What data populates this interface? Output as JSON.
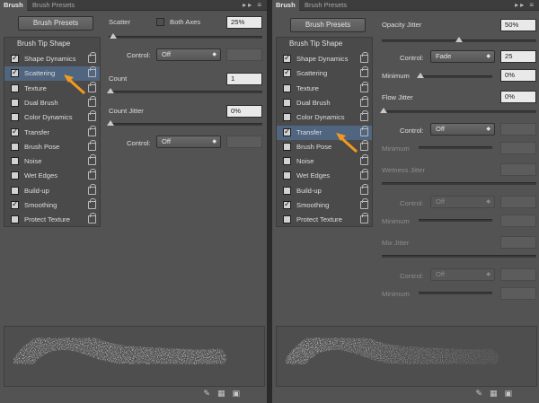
{
  "left": {
    "tabs": [
      "Brush",
      "Brush Presets"
    ],
    "presets_button": "Brush Presets",
    "tip_shape": "Brush Tip Shape",
    "items": [
      {
        "label": "Shape Dynamics",
        "checked": true,
        "selected": false
      },
      {
        "label": "Scattering",
        "checked": true,
        "selected": true
      },
      {
        "label": "Texture",
        "checked": false,
        "selected": false
      },
      {
        "label": "Dual Brush",
        "checked": false,
        "selected": false
      },
      {
        "label": "Color Dynamics",
        "checked": false,
        "selected": false
      },
      {
        "label": "Transfer",
        "checked": true,
        "selected": false
      },
      {
        "label": "Brush Pose",
        "checked": false,
        "selected": false
      },
      {
        "label": "Noise",
        "checked": false,
        "selected": false
      },
      {
        "label": "Wet Edges",
        "checked": false,
        "selected": false
      },
      {
        "label": "Build-up",
        "checked": false,
        "selected": false
      },
      {
        "label": "Smoothing",
        "checked": true,
        "selected": false
      },
      {
        "label": "Protect Texture",
        "checked": false,
        "selected": false
      }
    ],
    "scatter_label": "Scatter",
    "both_axes_label": "Both Axes",
    "scatter_value": "25%",
    "scatter_pct": 0.03,
    "control_label": "Control:",
    "control_value": "Off",
    "count_label": "Count",
    "count_value": "1",
    "count_jitter_label": "Count Jitter",
    "count_jitter_value": "0%",
    "control2_label": "Control:",
    "control2_value": "Off"
  },
  "right": {
    "tabs": [
      "Brush",
      "Brush Presets"
    ],
    "presets_button": "Brush Presets",
    "tip_shape": "Brush Tip Shape",
    "items": [
      {
        "label": "Shape Dynamics",
        "checked": true,
        "selected": false
      },
      {
        "label": "Scattering",
        "checked": true,
        "selected": false
      },
      {
        "label": "Texture",
        "checked": false,
        "selected": false
      },
      {
        "label": "Dual Brush",
        "checked": false,
        "selected": false
      },
      {
        "label": "Color Dynamics",
        "checked": false,
        "selected": false
      },
      {
        "label": "Transfer",
        "checked": true,
        "selected": true
      },
      {
        "label": "Brush Pose",
        "checked": false,
        "selected": false
      },
      {
        "label": "Noise",
        "checked": false,
        "selected": false
      },
      {
        "label": "Wet Edges",
        "checked": false,
        "selected": false
      },
      {
        "label": "Build-up",
        "checked": false,
        "selected": false
      },
      {
        "label": "Smoothing",
        "checked": true,
        "selected": false
      },
      {
        "label": "Protect Texture",
        "checked": false,
        "selected": false
      }
    ],
    "opacity_jitter_label": "Opacity Jitter",
    "opacity_jitter_value": "50%",
    "control_label": "Control:",
    "control_value": "Fade",
    "control_amount": "25",
    "minimum_label": "Minimum",
    "minimum_value": "0%",
    "flow_jitter_label": "Flow Jitter",
    "flow_jitter_value": "0%",
    "control2_label": "Control:",
    "control2_value": "Off",
    "minimum2_label": "Minimum",
    "wetness_jitter_label": "Wetness Jitter",
    "control3_label": "Control:",
    "control3_value": "Off",
    "minimum3_label": "Minimum",
    "mix_jitter_label": "Mix Jitter",
    "control4_label": "Control:",
    "control4_value": "Off",
    "minimum4_label": "Minimum"
  },
  "colors": {
    "panel": "#535353",
    "selection": "#50657f",
    "arrow": "#f29a1f"
  }
}
